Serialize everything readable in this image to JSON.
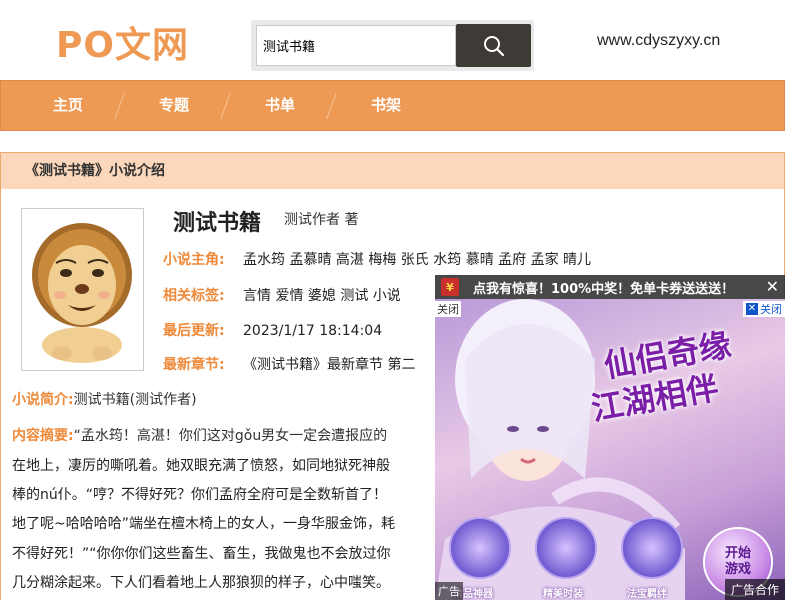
{
  "header": {
    "logo": "PO文网",
    "search_value": "测试书籍",
    "site_url": "www.cdyszyxy.cn"
  },
  "nav": {
    "items": [
      "主页",
      "专题",
      "书单",
      "书架"
    ]
  },
  "main": {
    "section_title": "《测试书籍》小说介绍",
    "book_title": "测试书籍",
    "book_author": "测试作者 著",
    "protagonists_label": "小说主角:",
    "protagonists": "孟水筠 孟慕晴 高湛 梅梅 张氏 水筠 慕晴 孟府 孟家 晴儿",
    "tags_label": "相关标签:",
    "tags": "言情 爱情 婆媳 测试 小说",
    "updated_label": "最后更新:",
    "updated": "2023/1/17 18:14:04",
    "latest_label": "最新章节:",
    "latest": "《测试书籍》最新章节 第二",
    "intro_label": "小说简介:",
    "intro": "测试书籍(测试作者)",
    "excerpt_label": "内容摘要:",
    "excerpt_lines": [
      "“孟水筠！高湛！你们这对gǒu男女一定会遭报应的",
      "在地上，凄厉的嘶吼着。她双眼充满了愤怒，如同地狱死神般",
      "棒的nú仆。“哼？不得好死？你们孟府全府可是全数斩首了！",
      "地了呢~哈哈哈哈”端坐在檀木椅上的女人，一身华服金饰，耗",
      "不得好死！”“你你你们这些畜生、畜生，我做鬼也不会放过你",
      "几分糊涂起来。下人们看着地上人那狼狈的样子，心中嗤笑。"
    ]
  },
  "ad": {
    "bar_text": "点我有惊喜！100%中奖！免单卡券送送送！",
    "small_close": "关闭",
    "x_close": "关闭",
    "slogan_line1": "仙侣奇缘",
    "slogan_line2": "江湖相伴",
    "start_button": "开始\n游戏",
    "item_labels": [
      "精品神器",
      "精美时装",
      "法宝羁绊"
    ],
    "label_left": "广告",
    "label_right": "广告合作"
  },
  "colors": {
    "accent": "#ee9a55",
    "label": "#ee8a3a",
    "title_bg": "#fbd8bb"
  }
}
